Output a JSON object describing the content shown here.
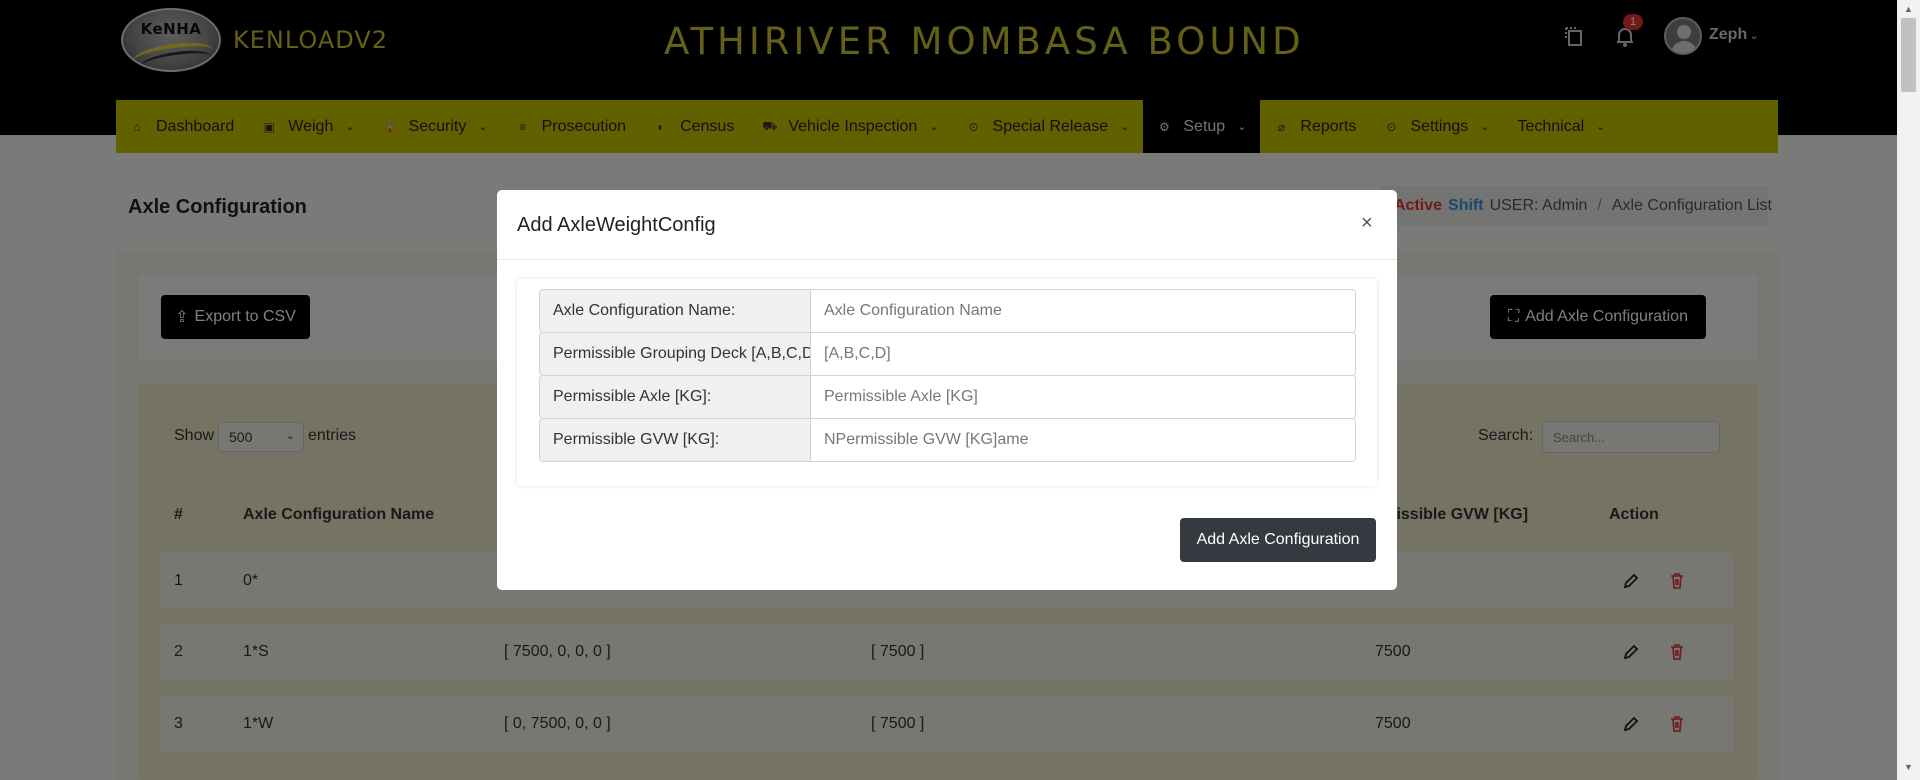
{
  "header": {
    "logo_text": "KeNHA",
    "brand": "KENLOADV2",
    "page_heading": "ATHIRIVER MOMBASA BOUND",
    "notification_count": "1",
    "username": "Zeph"
  },
  "nav": {
    "items": [
      {
        "label": "Dashboard",
        "icon": "home-icon",
        "glyph": "⌂",
        "dropdown": false,
        "active": false
      },
      {
        "label": "Weigh",
        "icon": "scale-icon",
        "glyph": "▣",
        "dropdown": true,
        "active": false
      },
      {
        "label": "Security",
        "icon": "lock-icon",
        "glyph": "🔒",
        "dropdown": true,
        "active": false
      },
      {
        "label": "Prosecution",
        "icon": "list-icon",
        "glyph": "≡",
        "dropdown": false,
        "active": false
      },
      {
        "label": "Census",
        "icon": "census-icon",
        "glyph": "◐",
        "dropdown": false,
        "active": false
      },
      {
        "label": "Vehicle Inspection",
        "icon": "truck-icon",
        "glyph": "⛟",
        "dropdown": true,
        "active": false
      },
      {
        "label": "Special Release",
        "icon": "target-icon",
        "glyph": "⊙",
        "dropdown": true,
        "active": false
      },
      {
        "label": "Setup",
        "icon": "gears-icon",
        "glyph": "⚙",
        "dropdown": true,
        "active": true
      },
      {
        "label": "Reports",
        "icon": "paperclip-icon",
        "glyph": "⌀",
        "dropdown": false,
        "active": false
      },
      {
        "label": "Settings",
        "icon": "settings-icon",
        "glyph": "⊙",
        "dropdown": true,
        "active": false
      },
      {
        "label": "Technical",
        "icon": "",
        "glyph": "",
        "dropdown": true,
        "active": false
      }
    ]
  },
  "page": {
    "title": "Axle Configuration",
    "breadcrumb": {
      "active": "Active",
      "shift": "Shift",
      "user": "USER: Admin",
      "current": "Axle Configuration List"
    },
    "export_button": "Export to CSV",
    "add_button": "Add Axle Configuration"
  },
  "table": {
    "show_label": "Show",
    "page_size": "500",
    "entries_label": "entries",
    "search_label": "Search:",
    "search_placeholder": "Search...",
    "headers": [
      "#",
      "Axle Configuration Name",
      "rmissible GVW [KG]",
      "Action"
    ],
    "rows": [
      {
        "num": "1",
        "name": "0*",
        "grouping": "",
        "axle": "",
        "gvw": ""
      },
      {
        "num": "2",
        "name": "1*S",
        "grouping": "[ 7500, 0, 0, 0 ]",
        "axle": "[ 7500 ]",
        "gvw": "7500"
      },
      {
        "num": "3",
        "name": "1*W",
        "grouping": "[ 0, 7500, 0, 0 ]",
        "axle": "[ 7500 ]",
        "gvw": "7500"
      }
    ]
  },
  "modal": {
    "title": "Add AxleWeightConfig",
    "close": "×",
    "fields": [
      {
        "label": "Axle Configuration Name:",
        "placeholder": "Axle Configuration Name",
        "value": ""
      },
      {
        "label": "Permissible Grouping Deck [A,B,C,D]:",
        "placeholder": "[A,B,C,D]",
        "value": ""
      },
      {
        "label": "Permissible Axle [KG]:",
        "placeholder": "Permissible Axle [KG]",
        "value": ""
      },
      {
        "label": "Permissible GVW [KG]:",
        "placeholder": "NPermissible GVW [KG]ame",
        "value": ""
      }
    ],
    "submit": "Add Axle Configuration"
  },
  "colors": {
    "nav_bg": "#c4c200",
    "brand_text": "#c9c12b",
    "active_nav": "#000000",
    "delete_red": "#e3342f",
    "shift_blue": "#3490dc"
  }
}
